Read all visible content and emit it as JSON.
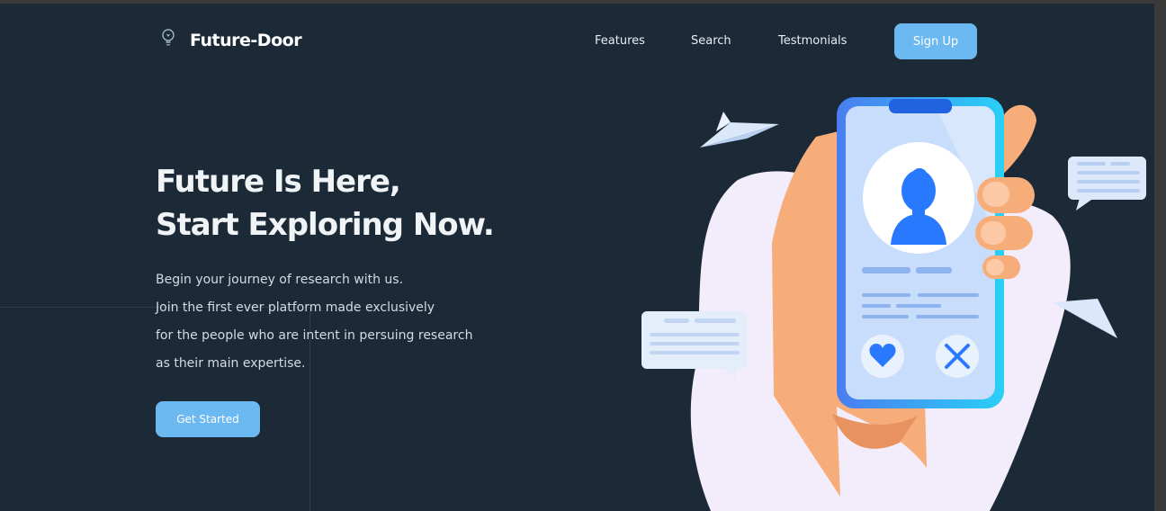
{
  "brand": {
    "name": "Future-Door",
    "logo_icon": "lightbulb-icon"
  },
  "nav": {
    "links": [
      "Features",
      "Search",
      "Testmonials"
    ],
    "signup_label": "Sign Up"
  },
  "hero": {
    "title_lines": [
      "Future Is Here,",
      "Start Exploring Now."
    ],
    "text_lines": [
      "Begin your journey of research with us.",
      "Join the first ever platform made exclusively",
      "for the people who are intent in persuing research",
      "as their main expertise."
    ],
    "cta_label": "Get Started"
  },
  "illustration": {
    "icons": [
      "paper-plane-icon",
      "phone-icon",
      "chat-bubble-icon",
      "heart-icon",
      "close-icon",
      "user-avatar-icon"
    ]
  },
  "colors": {
    "background": "#1c2a38",
    "accent": "#6cb8f0",
    "text": "#f1f4f7",
    "blob": "#f3ecfb",
    "hand": "#f7ad7a",
    "phone_blue": "#2979ff"
  }
}
